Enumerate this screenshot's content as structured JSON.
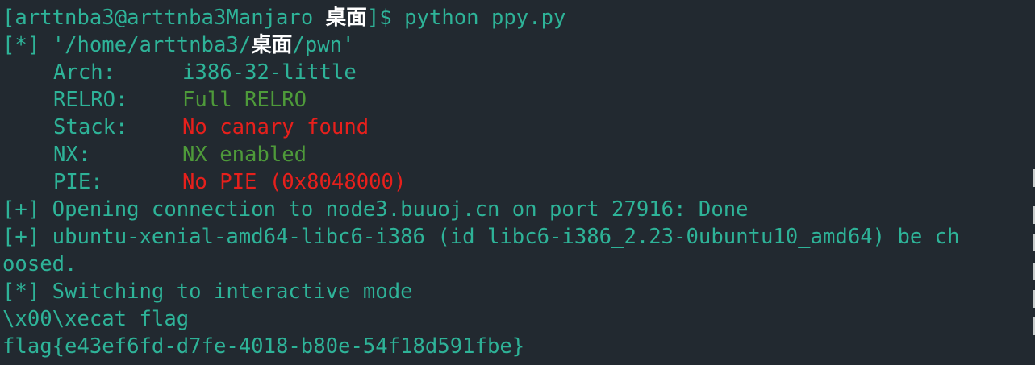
{
  "terminal": {
    "prompt": {
      "open": "[",
      "user_host": "arttnba3@arttnba3Manjaro",
      "dir": "桌面",
      "close": "]$",
      "command": "python ppy.py"
    },
    "binary": {
      "prefix": "[*]",
      "path_start": "'/home/arttnba3/",
      "path_dir": "桌面",
      "path_end": "/pwn'"
    },
    "checksec": [
      {
        "label": "Arch:",
        "value": "i386-32-little",
        "status": "neutral"
      },
      {
        "label": "RELRO:",
        "value": "Full RELRO",
        "status": "good"
      },
      {
        "label": "Stack:",
        "value": "No canary found",
        "status": "bad"
      },
      {
        "label": "NX:",
        "value": "NX enabled",
        "status": "good"
      },
      {
        "label": "PIE:",
        "value": "No PIE (0x8048000)",
        "status": "bad"
      }
    ],
    "messages": {
      "opening_prefix": "[+]",
      "opening_text": "Opening connection to node3.buuoj.cn on port 27916: Done",
      "libc_prefix": "[+]",
      "libc_text_line1": "ubuntu-xenial-amd64-libc6-i386 (id libc6-i386_2.23-0ubuntu10_amd64) be ch",
      "libc_text_line2": "oosed.",
      "interactive_prefix": "[*]",
      "interactive_text": "Switching to interactive mode"
    },
    "output": {
      "echo_line": "\\x00\\xecat flag",
      "flag_line": "flag{e43ef6fd-d7fe-4018-b80e-54f18d591fbe}"
    }
  },
  "colors": {
    "background": "#222930",
    "accent": "#2eb398",
    "text": "#e8ecec",
    "good": "#4e9a3a",
    "bad": "#e7201c"
  }
}
